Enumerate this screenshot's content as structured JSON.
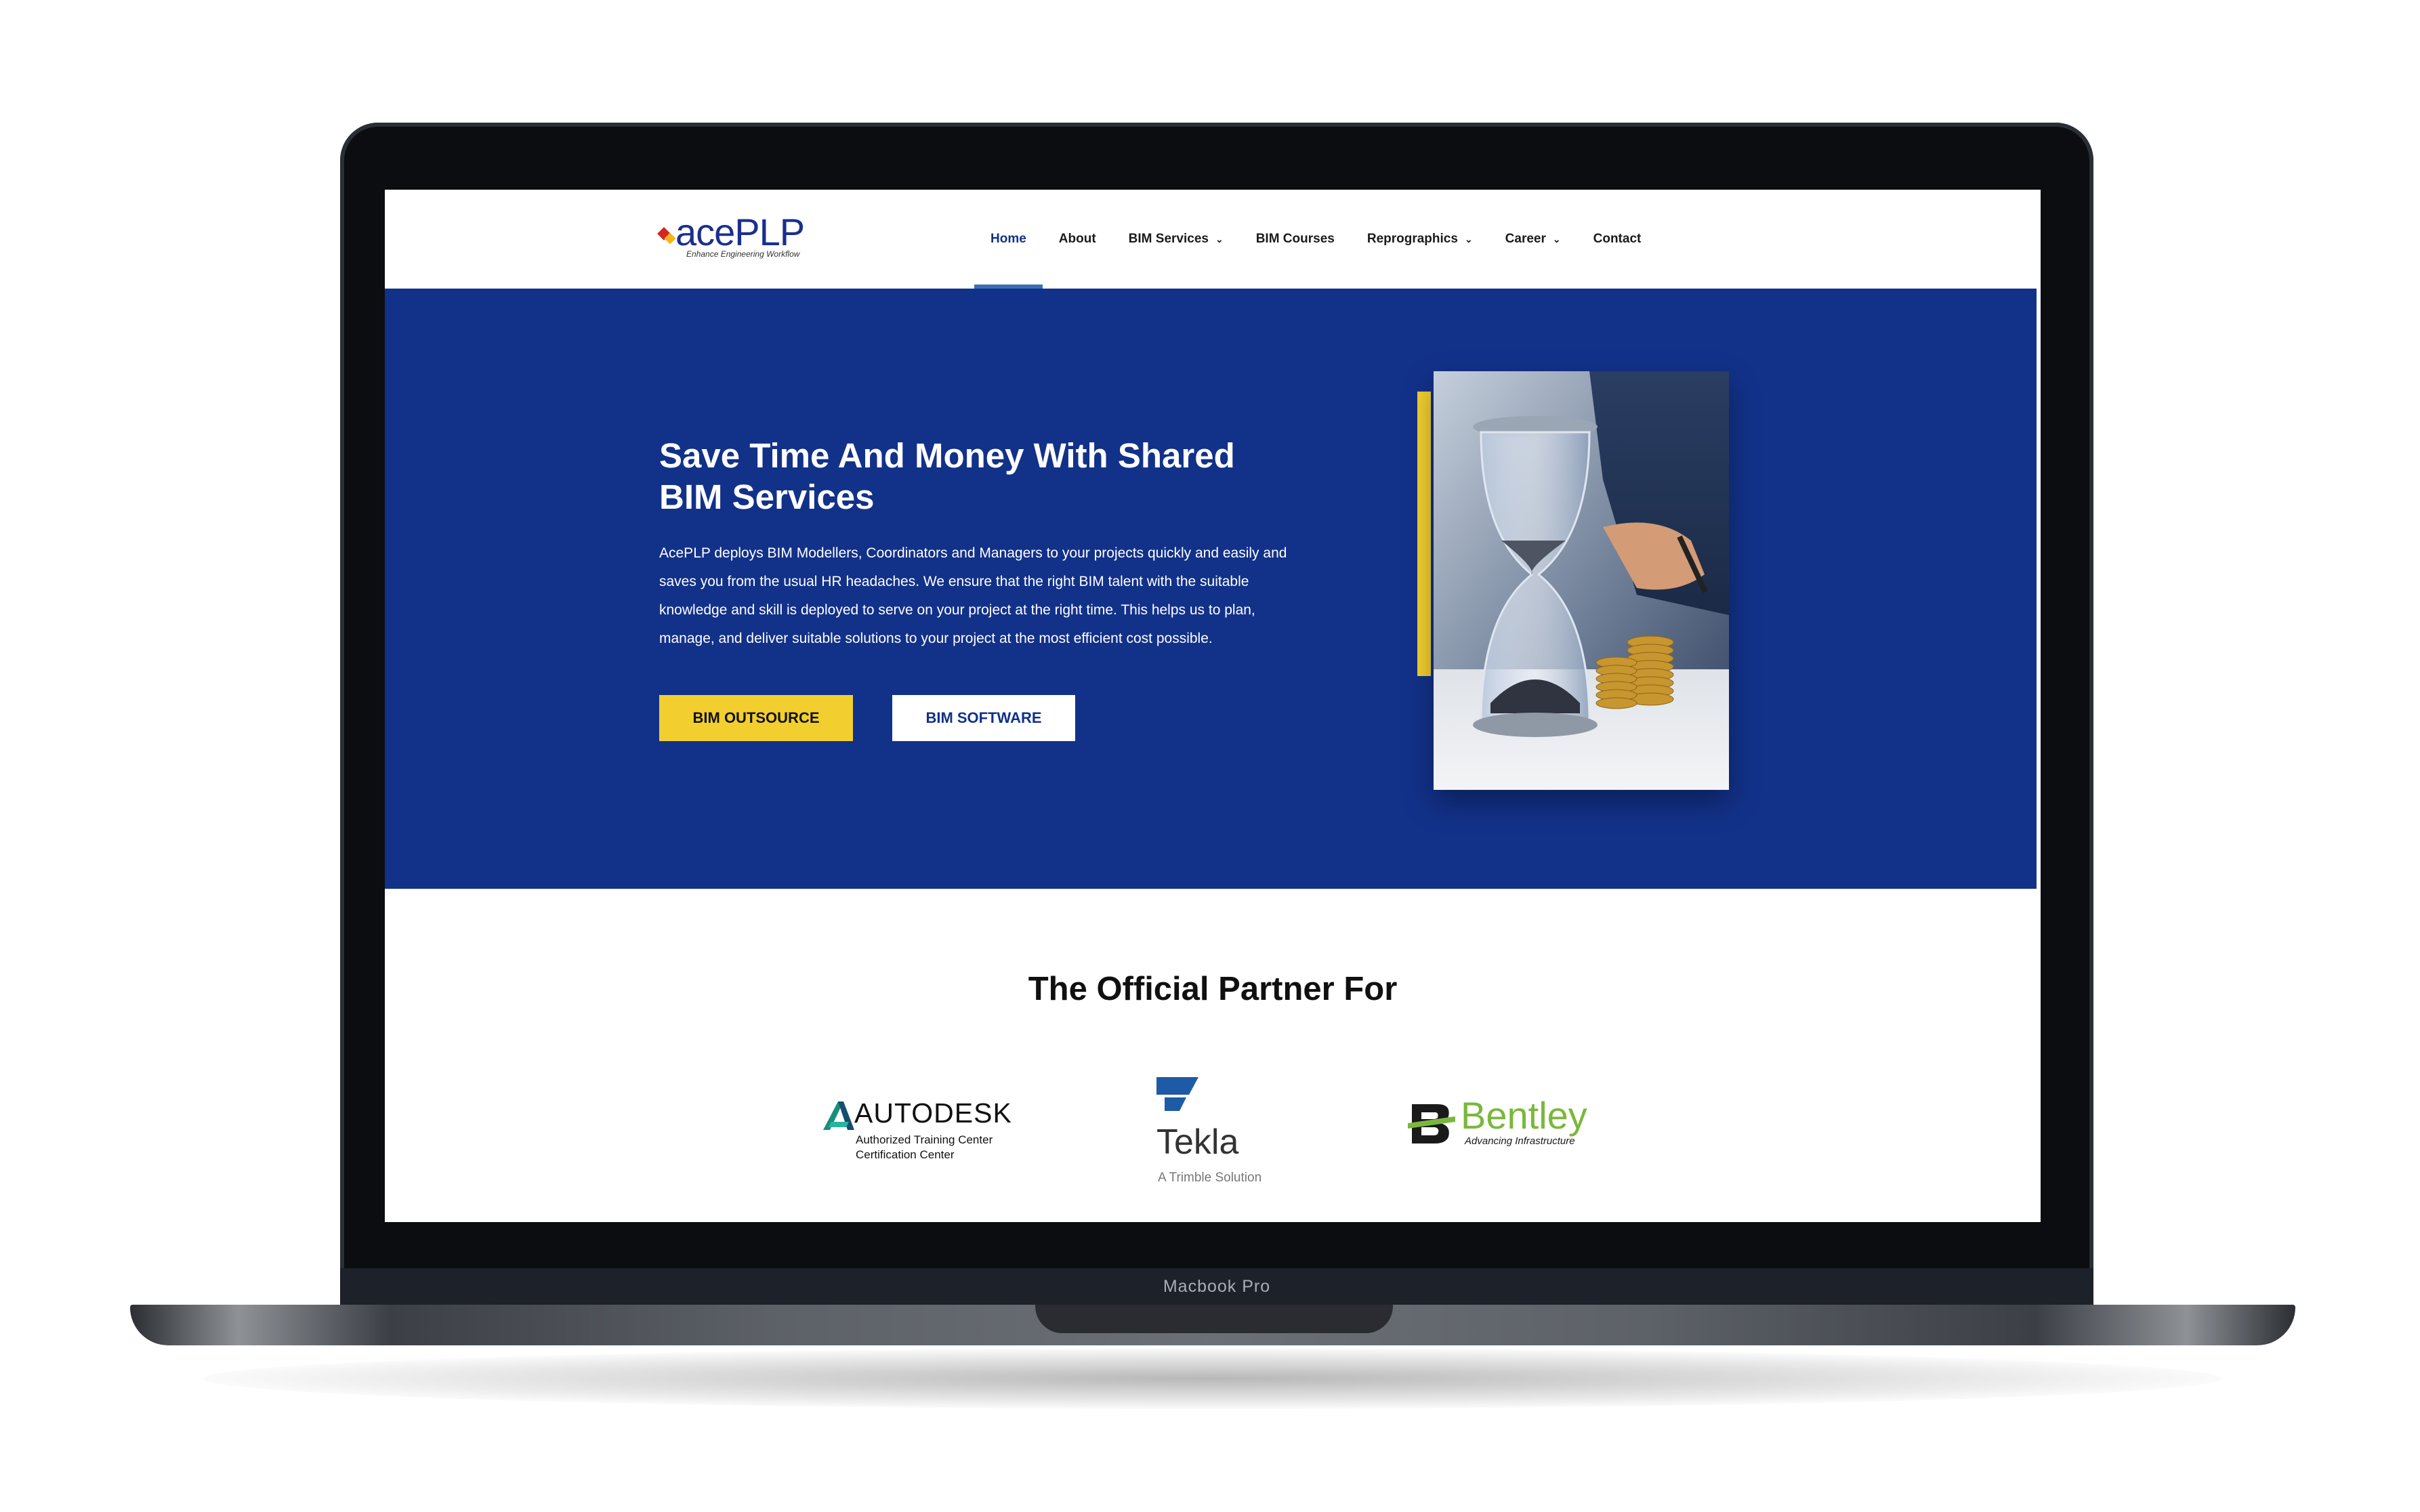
{
  "device": {
    "model_label": "Macbook Pro"
  },
  "site": {
    "logo": {
      "name_ace": "ace",
      "name_plp": "PLP",
      "tagline": "Enhance Engineering Workflow"
    },
    "nav": [
      {
        "label": "Home",
        "active": true,
        "dropdown": false
      },
      {
        "label": "About",
        "active": false,
        "dropdown": false
      },
      {
        "label": "BIM Services",
        "active": false,
        "dropdown": true
      },
      {
        "label": "BIM Courses",
        "active": false,
        "dropdown": false
      },
      {
        "label": "Reprographics",
        "active": false,
        "dropdown": true
      },
      {
        "label": "Career",
        "active": false,
        "dropdown": true
      },
      {
        "label": "Contact",
        "active": false,
        "dropdown": false
      }
    ],
    "hero": {
      "title_line1": "Save Time And Money With Shared",
      "title_line2": "BIM Services",
      "text_line1": "AcePLP deploys BIM Modellers, Coordinators and Managers to your projects quickly and easily and",
      "text_line2": "saves you from the usual HR headaches. We ensure that the right BIM talent with the suitable",
      "text_line3": "knowledge and skill is deployed to serve on your project at the right time. This helps us to plan,",
      "text_line4": "manage, and deliver suitable solutions to your project at the most efficient cost possible.",
      "button_primary": "BIM OUTSOURCE",
      "button_secondary": "BIM SOFTWARE",
      "image_subject": "hourglass-with-coins"
    },
    "partners": {
      "title": "The Official Partner For",
      "autodesk": {
        "name": "AUTODESK",
        "sub1": "Authorized Training Center",
        "sub2": "Certification Center"
      },
      "tekla": {
        "name": "Tekla",
        "sub": "A Trimble Solution"
      },
      "bentley": {
        "name": "Bentley",
        "sub": "Advancing Infrastructure"
      }
    }
  },
  "colors": {
    "brand_blue": "#123189",
    "accent_yellow": "#f2cf2e",
    "bentley_green": "#7bb73c",
    "tekla_blue": "#1f5aa6"
  }
}
